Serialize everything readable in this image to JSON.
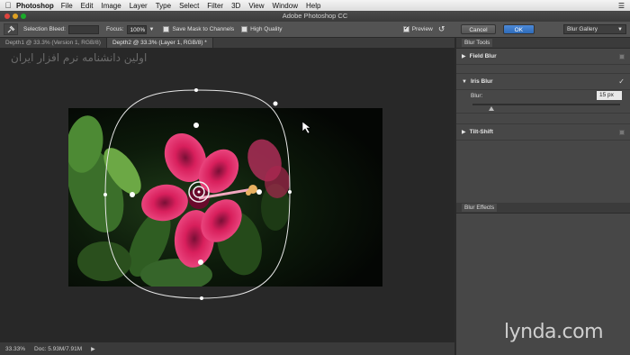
{
  "menubar": {
    "apple_icon": "apple-icon",
    "app_name": "Photoshop",
    "items": [
      "File",
      "Edit",
      "Image",
      "Layer",
      "Type",
      "Select",
      "Filter",
      "3D",
      "View",
      "Window",
      "Help"
    ]
  },
  "window": {
    "title": "Adobe Photoshop CC"
  },
  "options_bar": {
    "selection_bleed_label": "Selection Bleed:",
    "focus_label": "Focus:",
    "focus_value": "100%",
    "save_mask_label": "Save Mask to Channels",
    "high_quality_label": "High Quality",
    "preview_label": "Preview",
    "preview_checked": true,
    "cancel_label": "Cancel",
    "ok_label": "OK",
    "workspace_value": "Blur Gallery"
  },
  "tabs": [
    {
      "label": "Depth1 @ 33.3% (Version 1, RGB/8)",
      "active": false
    },
    {
      "label": "Depth2 @ 33.3% (Layer 1, RGB/8) *",
      "active": true
    }
  ],
  "watermark": "اولین دانشنامه نرم افزار ایران",
  "status": {
    "zoom": "33.33%",
    "doc": "Doc: 5.93M/7.91M"
  },
  "panels": {
    "blur_tools_title": "Blur Tools",
    "field_blur": "Field Blur",
    "iris_blur": "Iris Blur",
    "iris_blur_enabled": true,
    "blur_label": "Blur:",
    "blur_value": "15 px",
    "blur_amount": 15,
    "tilt_shift": "Tilt-Shift",
    "blur_effects_title": "Blur Effects"
  },
  "brand": "lynda.com",
  "colors": {
    "ok_button": "#2e6bb9",
    "flower": "#e8245f"
  }
}
